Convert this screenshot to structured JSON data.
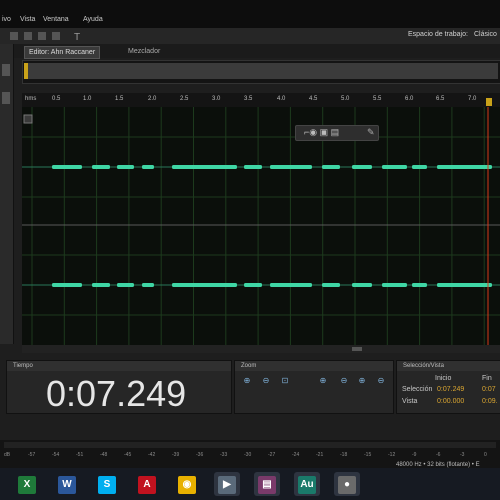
{
  "menu": {
    "items": [
      "ivo",
      "Vista",
      "Ventana",
      "Ayuda"
    ]
  },
  "toolbar": {
    "workspace_label": "Espacio de trabajo:",
    "workspace_value": "Clásico"
  },
  "tabs": [
    {
      "label": "Editor: Ahn Raccaner",
      "active": true
    },
    {
      "label": "Mezclador",
      "active": false
    }
  ],
  "ruler": {
    "unit": "hms",
    "ticks": [
      "0.5",
      "1.0",
      "1.5",
      "2.0",
      "2.5",
      "3.0",
      "3.5",
      "4.0",
      "4.5",
      "5.0",
      "5.5",
      "6.0",
      "6.5",
      "7.0",
      "7"
    ]
  },
  "time_panel": {
    "title": "Tiempo",
    "value": "0:07.249"
  },
  "zoom_panel": {
    "title": "Zoom"
  },
  "selection_panel": {
    "title": "Selección/Vista",
    "col_start": "Inicio",
    "col_end": "Fin",
    "rows": [
      {
        "label": "Selección",
        "start": "0:07.249",
        "end": "0:07"
      },
      {
        "label": "Vista",
        "start": "0:00.000",
        "end": "0:09."
      }
    ]
  },
  "meter": {
    "ticks": [
      "dB",
      "-57",
      "-54",
      "-51",
      "-48",
      "-45",
      "-42",
      "-39",
      "-36",
      "-33",
      "-30",
      "-27",
      "-24",
      "-21",
      "-18",
      "-15",
      "-12",
      "-9",
      "-6",
      "-3",
      "0"
    ]
  },
  "status": {
    "text": "48000 Hz • 32 bits (flotante) • E"
  },
  "taskbar": {
    "apps": [
      {
        "name": "excel-icon",
        "glyph": "X",
        "color": "#1f7a3a"
      },
      {
        "name": "word-icon",
        "glyph": "W",
        "color": "#2b579a"
      },
      {
        "name": "skype-icon",
        "glyph": "S",
        "color": "#00aff0"
      },
      {
        "name": "acrobat-icon",
        "glyph": "A",
        "color": "#c1121f"
      },
      {
        "name": "chrome-icon",
        "glyph": "◉",
        "color": "#e8b100"
      },
      {
        "name": "media-player-icon",
        "glyph": "▶",
        "color": "#5a6a7a"
      },
      {
        "name": "winrar-icon",
        "glyph": "▤",
        "color": "#7a3a6a"
      },
      {
        "name": "audition-icon",
        "glyph": "Au",
        "color": "#1a7a6a"
      },
      {
        "name": "camtasia-icon",
        "glyph": "●",
        "color": "#6a6a6a"
      }
    ]
  },
  "colors": {
    "waveform": "#3fd6a5",
    "playhead": "#d63a1a",
    "selection_value": "#d9a531"
  }
}
